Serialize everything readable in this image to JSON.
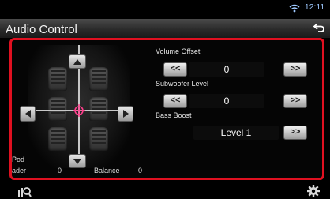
{
  "status": {
    "time": "12:11"
  },
  "header": {
    "title": "Audio Control"
  },
  "seat_panel": {
    "source_label": "Pod",
    "fader_label": "ader",
    "fader_value": "0",
    "balance_label": "Balance",
    "balance_value": "0"
  },
  "controls": {
    "volume_offset": {
      "label": "Volume Offset",
      "value": "0",
      "dec": "<<",
      "inc": ">>"
    },
    "subwoofer_level": {
      "label": "Subwoofer Level",
      "value": "0",
      "dec": "<<",
      "inc": ">>"
    },
    "bass_boost": {
      "label": "Bass Boost",
      "value": "Level 1",
      "inc": ">>"
    }
  },
  "colors": {
    "highlight_border": "#e01020",
    "clock": "#9ec9ff"
  }
}
